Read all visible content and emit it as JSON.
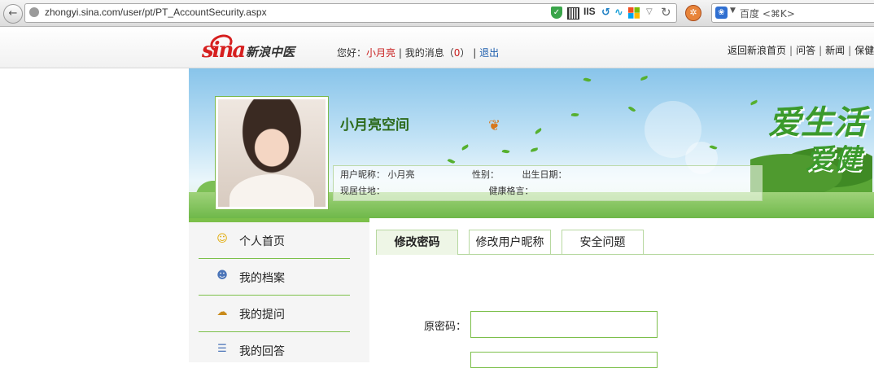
{
  "browser": {
    "url": "zhongyi.sina.com/user/pt/PT_AccountSecurity.aspx",
    "iis_label": "IIS",
    "search_placeholder": "百度 <⌘K>",
    "icons": [
      "back-arrow-icon",
      "globe-icon",
      "shield-icon",
      "qr-code-icon",
      "windows-icon",
      "reload-icon",
      "addon-icon",
      "baidu-paw-icon"
    ]
  },
  "header": {
    "logo_text": "sina",
    "logo_sub": "新浪中医",
    "greeting_prefix": "您好：",
    "username": "小月亮",
    "sep": "|",
    "messages_label": "我的消息（",
    "messages_count": "0",
    "messages_close": "）",
    "logout": "退出",
    "top_links": [
      "返回新浪首页",
      "问答",
      "新闻",
      "保健"
    ]
  },
  "banner": {
    "space_title": "小月亮空间",
    "slogan_line1": "爱生活",
    "slogan_line2": "爱健",
    "nickname_label": "用户昵称：",
    "nickname_value": "小月亮",
    "gender_label": "性别：",
    "birthday_label": "出生日期：",
    "residence_label": "现居住地：",
    "motto_label": "健康格言：",
    "colors": {
      "sky": "#88c4ea",
      "grass": "#6fb84a",
      "slogan": "#3b9a2c"
    }
  },
  "sidebar": {
    "items": [
      {
        "label": "个人首页",
        "icon": "smiley-icon"
      },
      {
        "label": "我的档案",
        "icon": "user-profile-icon"
      },
      {
        "label": "我的提问",
        "icon": "chat-bubbles-icon"
      },
      {
        "label": "我的回答",
        "icon": "document-icon"
      }
    ],
    "accent": "#7cc04a"
  },
  "tabs": [
    {
      "label": "修改密码",
      "active": true
    },
    {
      "label": "修改用户昵称",
      "active": false
    },
    {
      "label": "安全问题",
      "active": false
    }
  ],
  "form": {
    "old_password_label": "原密码：",
    "old_password_value": ""
  }
}
